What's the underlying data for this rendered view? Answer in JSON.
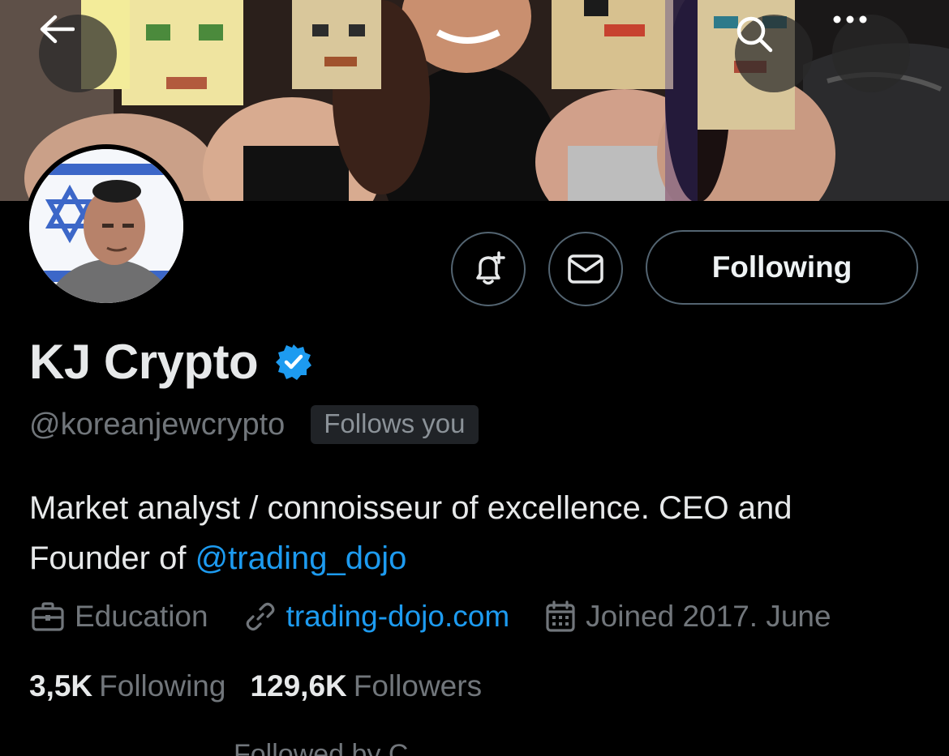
{
  "header": {
    "back_icon": "arrow-left-icon",
    "search_icon": "search-icon",
    "more_icon": "more-horizontal-icon"
  },
  "profile": {
    "display_name": "KJ Crypto",
    "verified_icon": "verified-badge-icon",
    "handle": "@koreanjewcrypto",
    "follows_you": "Follows you",
    "bio_text": "Market analyst / connoisseur of excellence. CEO and Founder of ",
    "bio_mention": "@trading_dojo"
  },
  "actions": {
    "notify_icon": "bell-plus-icon",
    "message_icon": "mail-icon",
    "follow_label": "Following"
  },
  "meta": {
    "category": "Education",
    "website": "trading-dojo.com",
    "joined": "Joined 2017. June"
  },
  "stats": {
    "following_count": "3,5K",
    "following_label": "Following",
    "followers_count": "129,6K",
    "followers_label": "Followers"
  },
  "followed_by": {
    "text": "Followed by C..."
  },
  "colors": {
    "accent": "#1d9bf0",
    "background": "#000000",
    "secondary_text": "#71767b",
    "border": "#536471"
  }
}
